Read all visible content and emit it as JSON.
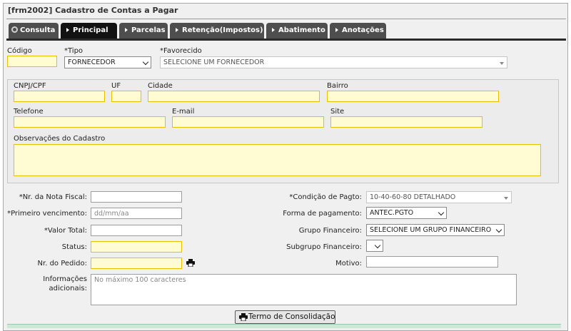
{
  "window": {
    "title": "[frm2002] Cadastro de Contas a Pagar"
  },
  "tabs": [
    {
      "label": "Consulta",
      "icon": "magnifier-icon"
    },
    {
      "label": "Principal",
      "icon": "arrow-right-icon",
      "active": true
    },
    {
      "label": "Parcelas",
      "icon": "arrow-right-icon"
    },
    {
      "label": "Retenção(Impostos)",
      "icon": "arrow-right-icon"
    },
    {
      "label": "Abatimento",
      "icon": "arrow-right-icon"
    },
    {
      "label": "Anotações",
      "icon": "arrow-right-icon"
    }
  ],
  "top": {
    "codigo_label": "Código",
    "codigo_value": "",
    "tipo_label": "*Tipo",
    "tipo_value": "FORNECEDOR",
    "favorecido_label": "*Favorecido",
    "favorecido_value": "SELECIONE UM FORNECEDOR"
  },
  "cadastro": {
    "cnpj_label": "CNPJ/CPF",
    "uf_label": "UF",
    "cidade_label": "Cidade",
    "bairro_label": "Bairro",
    "telefone_label": "Telefone",
    "email_label": "E-mail",
    "site_label": "Site",
    "observacoes_label": "Observações do Cadastro"
  },
  "form": {
    "nota_label": "*Nr. da Nota Fiscal:",
    "vencimento_label": "*Primeiro vencimento:",
    "vencimento_placeholder": "dd/mm/aa",
    "valor_label": "*Valor Total:",
    "status_label": "Status:",
    "pedido_label": "Nr. do Pedido:",
    "info_label_line1": "Informações",
    "info_label_line2": "adicionais:",
    "info_placeholder": "No máximo 100 caracteres",
    "condicao_label": "*Condição de Pagto:",
    "condicao_value": "10-40-60-80 DETALHADO",
    "forma_label": "Forma de pagamento:",
    "forma_value": "ANTEC.PGTO",
    "grupo_label": "Grupo Financeiro:",
    "grupo_value": "SELECIONE UM GRUPO FINANCEIRO",
    "subgrupo_label": "Subgrupo Financeiro:",
    "subgrupo_value": "",
    "motivo_label": "Motivo:",
    "termo_button": "Termo de Consolidação"
  },
  "colors": {
    "required_field_bg": "#fffbd2",
    "required_field_border": "#e8c000",
    "tab_active": "#121212",
    "tab_inactive": "#4e4e4e"
  }
}
